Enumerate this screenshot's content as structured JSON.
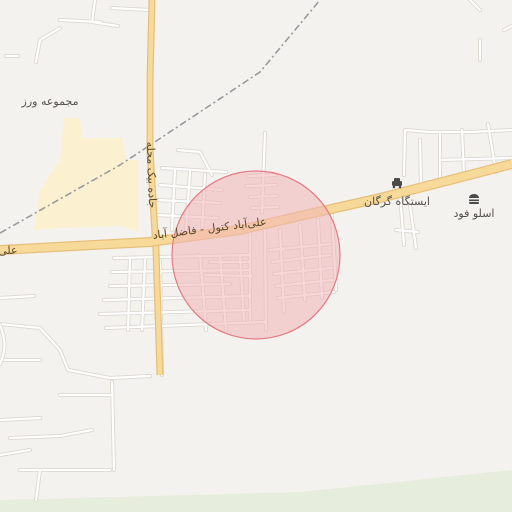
{
  "map": {
    "colors": {
      "background": "#f4f2ee",
      "minor_road": "#ffffff",
      "minor_road_casing": "#dcd8d0",
      "main_road": "#f7d99a",
      "main_road_casing": "#e6c07a",
      "railway": "#9a9a9a",
      "industrial_area": "#fbf0cf",
      "park_area": "#e7eddc",
      "highlight_fill": "#f3b5b8",
      "highlight_stroke": "#e27c84",
      "label_text": "#55524c"
    },
    "highlight": {
      "shape": "circle",
      "meaning": "selected area"
    },
    "labels": {
      "main_road": "علی‌آباد کتول - فاضل آباد",
      "main_road_left_fragment": "علی",
      "side_road": "جاده بیک محله",
      "district": "مجموعه ورز",
      "gas_station": "ایستگاه گرگان",
      "restaurant": "اسلو فود"
    },
    "pois": [
      {
        "name_key": "gas_station",
        "icon": "car-icon"
      },
      {
        "name_key": "restaurant",
        "icon": "burger-icon"
      }
    ]
  }
}
